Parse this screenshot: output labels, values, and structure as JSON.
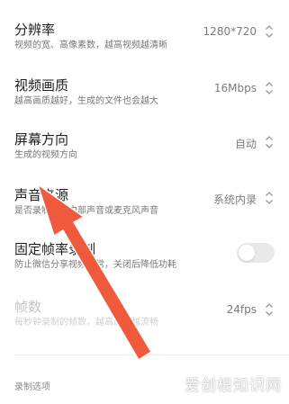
{
  "settings": [
    {
      "title": "分辨率",
      "desc": "视频的宽、高像素数，越高视频越清晰",
      "value": "1280*720"
    },
    {
      "title": "视频画质",
      "desc": "越高画质越好，生成的文件也会越大",
      "value": "16Mbps"
    },
    {
      "title": "屏幕方向",
      "desc": "生成的视频方向",
      "value": "自动"
    },
    {
      "title": "声音来源",
      "desc": "是否录制系统内部声音或麦克风声音",
      "value": "系统内录"
    },
    {
      "title": "固定帧率录制",
      "desc": "防止微信分享视频异常，关闭后降低功耗",
      "toggle_on": false
    },
    {
      "title": "帧数",
      "desc": "每秒钟录制的帧数，越高画面越流畅",
      "value": "24fps",
      "disabled": true
    }
  ],
  "footer": {
    "label": "录制选项"
  },
  "watermark": {
    "text": "爱创根知识网"
  },
  "annotation": {
    "arrow_color": "#ef5a3c"
  },
  "icons": {
    "selector": "chevron-up-down-icon"
  }
}
